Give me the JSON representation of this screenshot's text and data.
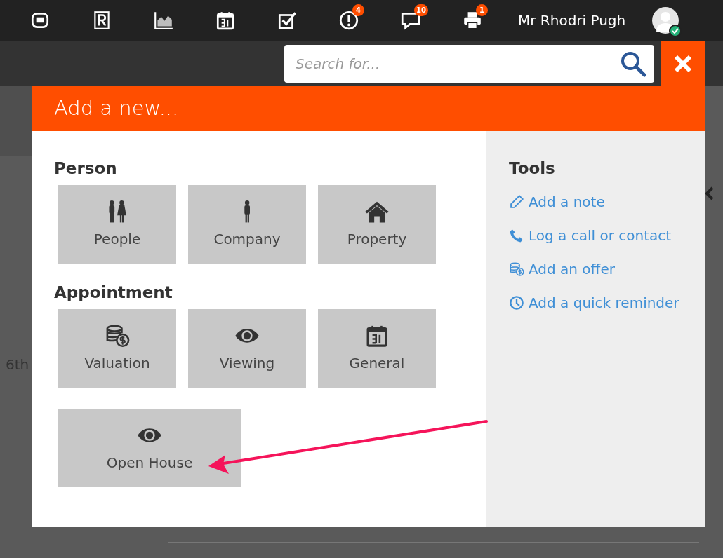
{
  "topbar": {
    "icons": [
      {
        "kind": "pm"
      },
      {
        "kind": "r"
      },
      {
        "kind": "chart"
      },
      {
        "kind": "calendar"
      },
      {
        "kind": "tasks"
      },
      {
        "kind": "alert",
        "badge": "4"
      },
      {
        "kind": "chat",
        "badge": "10"
      },
      {
        "kind": "printer",
        "badge": "1"
      }
    ],
    "user_name": "Mr Rhodri Pugh",
    "user_online": true
  },
  "search": {
    "placeholder": "Search for..."
  },
  "background": {
    "date_label": "6th"
  },
  "modal": {
    "title": "Add a new...",
    "sections": [
      {
        "heading": "Person",
        "tiles": [
          {
            "label": "People",
            "kind": "people"
          },
          {
            "label": "Company",
            "kind": "person"
          },
          {
            "label": "Property",
            "kind": "house"
          }
        ]
      },
      {
        "heading": "Appointment",
        "tiles": [
          {
            "label": "Valuation",
            "kind": "coins",
            "wide": false
          },
          {
            "label": "Viewing",
            "kind": "eye",
            "wide": false
          },
          {
            "label": "General",
            "kind": "calendar",
            "wide": false
          },
          {
            "label": "Open House",
            "kind": "eye",
            "wide": true
          }
        ]
      }
    ],
    "tools": {
      "heading": "Tools",
      "links": [
        {
          "label": "Add a note",
          "kind": "pencil"
        },
        {
          "label": "Log a call or contact",
          "kind": "phone"
        },
        {
          "label": "Add an offer",
          "kind": "coins"
        },
        {
          "label": "Add a quick reminder",
          "kind": "clock"
        }
      ]
    }
  }
}
